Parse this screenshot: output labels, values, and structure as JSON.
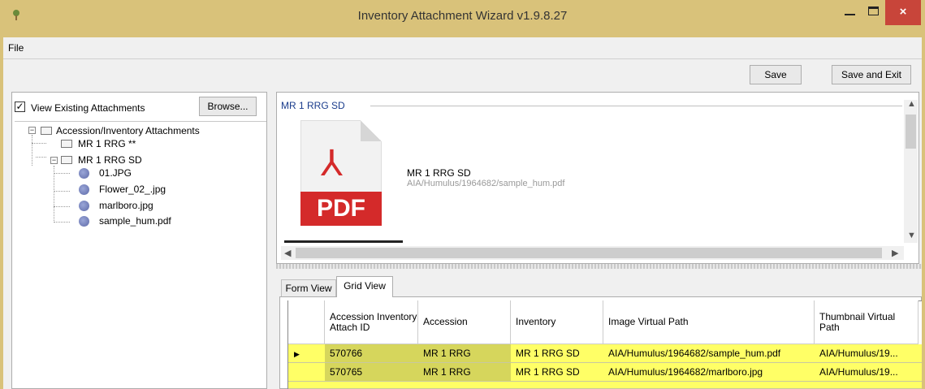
{
  "window": {
    "title": "Inventory Attachment Wizard v1.9.8.27",
    "close_glyph": "×"
  },
  "menu": {
    "file": "File"
  },
  "toolbar": {
    "save": "Save",
    "save_exit": "Save and Exit"
  },
  "left": {
    "view_existing": "View Existing Attachments",
    "checked": true,
    "browse": "Browse...",
    "tree": {
      "root": "Accession/Inventory Attachments",
      "node1": "MR 1 RRG **",
      "node2": "MR 1 RRG SD",
      "files": [
        "01.JPG",
        "Flower_02_.jpg",
        "marlboro.jpg",
        "sample_hum.pdf"
      ]
    }
  },
  "preview": {
    "group_title": "MR 1 RRG SD",
    "pdf_label": "PDF",
    "file_name": "MR 1 RRG SD",
    "file_path": "AIA/Humulus/1964682/sample_hum.pdf"
  },
  "tabs": {
    "form": "Form View",
    "grid": "Grid View"
  },
  "grid": {
    "headers": [
      "Accession Inventory Attach ID",
      "Accession",
      "Inventory",
      "Image Virtual Path",
      "Thumbnail Virtual Path"
    ],
    "rows": [
      [
        "570766",
        "MR 1 RRG",
        "MR 1 RRG SD",
        "AIA/Humulus/1964682/sample_hum.pdf",
        "AIA/Humulus/19..."
      ],
      [
        "570765",
        "MR 1 RRG",
        "MR 1 RRG SD",
        "AIA/Humulus/1964682/marlboro.jpg",
        "AIA/Humulus/19..."
      ]
    ]
  },
  "colors": {
    "titlebar": "#d9c27a",
    "close": "#c8453a",
    "row_highlight": "#ffff66",
    "pdf_red": "#d42a2a"
  }
}
